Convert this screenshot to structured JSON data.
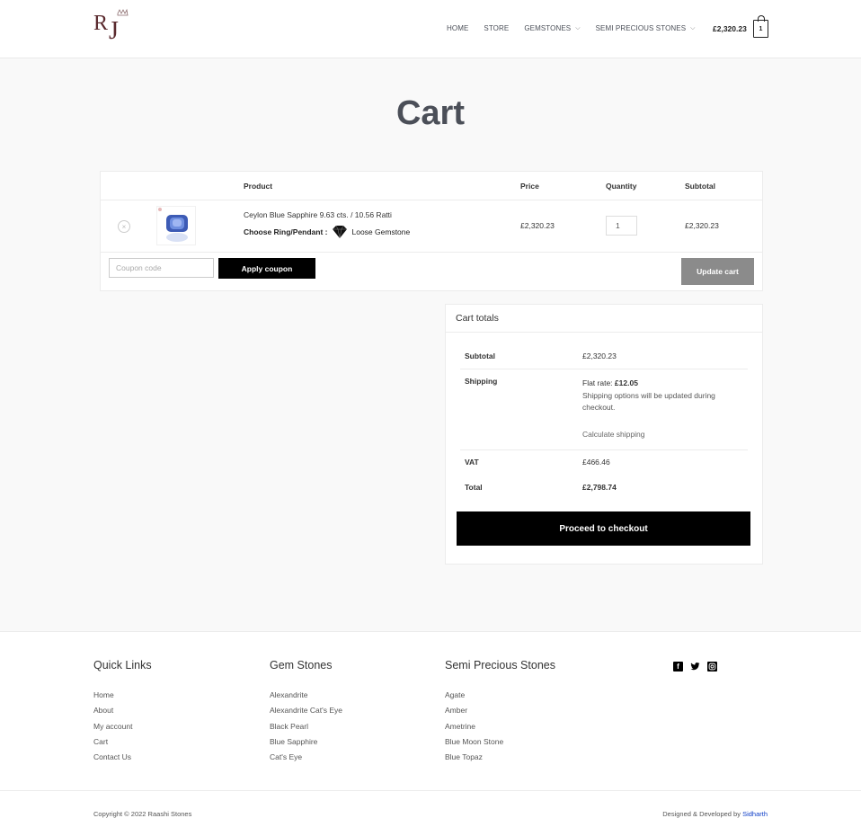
{
  "header": {
    "logo_text": "RJ",
    "nav": [
      {
        "label": "HOME",
        "has_dropdown": false
      },
      {
        "label": "STORE",
        "has_dropdown": false
      },
      {
        "label": "GEMSTONES",
        "has_dropdown": true
      },
      {
        "label": "SEMI PRECIOUS STONES",
        "has_dropdown": true
      }
    ],
    "cart_total": "£2,320.23",
    "cart_count": "1"
  },
  "page": {
    "title": "Cart"
  },
  "cart_table": {
    "columns": [
      "Product",
      "Price",
      "Quantity",
      "Subtotal"
    ],
    "items": [
      {
        "name": "Ceylon Blue Sapphire 9.63 cts. / 10.56 Ratti",
        "option_label": "Choose Ring/Pendant :",
        "option_value": "Loose Gemstone",
        "price": "£2,320.23",
        "quantity": "1",
        "subtotal": "£2,320.23"
      }
    ],
    "coupon_placeholder": "Coupon code",
    "apply_coupon_label": "Apply coupon",
    "update_cart_label": "Update cart"
  },
  "totals": {
    "title": "Cart totals",
    "subtotal_label": "Subtotal",
    "subtotal_value": "£2,320.23",
    "shipping_label": "Shipping",
    "shipping_rate_label": "Flat rate:",
    "shipping_rate_value": "£12.05",
    "shipping_note": "Shipping options will be updated during checkout.",
    "calculate_shipping": "Calculate shipping",
    "vat_label": "VAT",
    "vat_value": "£466.46",
    "total_label": "Total",
    "total_value": "£2,798.74",
    "checkout_label": "Proceed to checkout"
  },
  "footer": {
    "quick_links": {
      "title": "Quick Links",
      "links": [
        "Home",
        "About",
        "My account",
        "Cart",
        "Contact Us"
      ]
    },
    "gem_stones": {
      "title": "Gem Stones",
      "links": [
        "Alexandrite",
        "Alexandrite Cat's Eye",
        "Black Pearl",
        "Blue Sapphire",
        "Cat's Eye"
      ]
    },
    "semi_precious": {
      "title": "Semi Precious Stones",
      "links": [
        "Agate",
        "Amber",
        "Ametrine",
        "Blue Moon Stone",
        "Blue Topaz"
      ]
    },
    "socials": [
      "facebook-icon",
      "twitter-icon",
      "instagram-icon"
    ],
    "copyright": "Copyright © 2022 Raashi Stones",
    "credit_prefix": "Designed & Developed by",
    "credit_author": "Sidharth"
  },
  "colors": {
    "accent_black": "#000000",
    "update_button": "#8b8b8b",
    "credit_link": "#0e3ec8"
  }
}
